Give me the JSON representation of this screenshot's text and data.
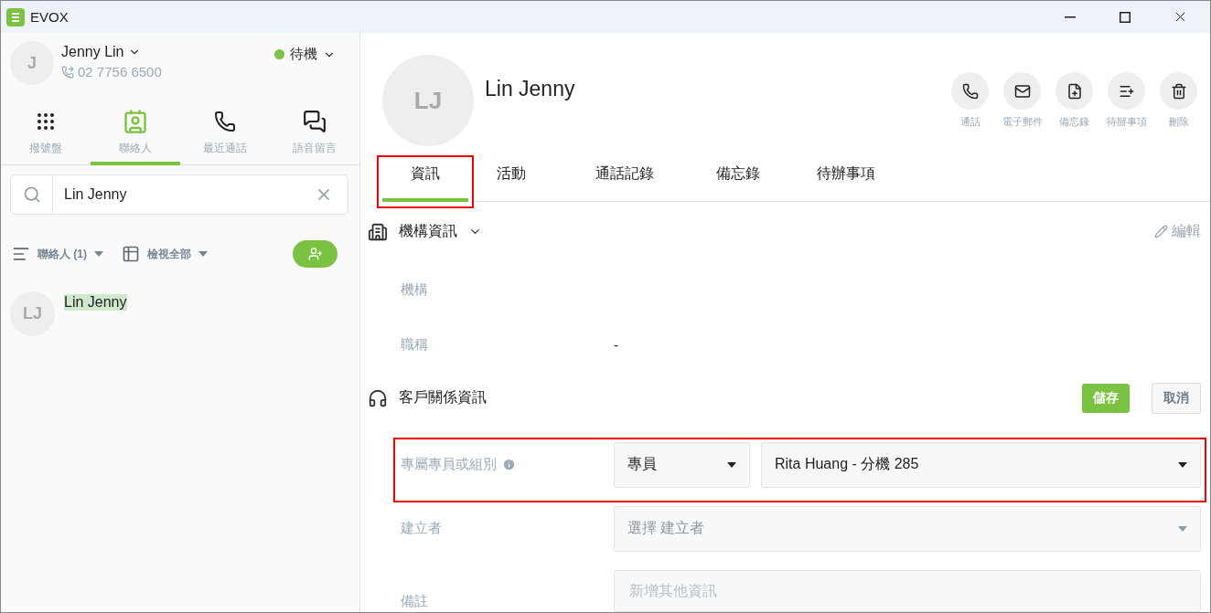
{
  "window": {
    "title": "EVOX"
  },
  "user": {
    "initial": "J",
    "name": "Jenny Lin",
    "phone": "02 7756 6500",
    "status": "待機"
  },
  "nav": [
    {
      "label": "撥號盤",
      "selected": false
    },
    {
      "label": "聯絡人",
      "selected": true
    },
    {
      "label": "最近通話",
      "selected": false
    },
    {
      "label": "語音留言",
      "selected": false
    }
  ],
  "search": {
    "value": "Lin Jenny"
  },
  "filters": [
    {
      "label": "聯絡人 (1)"
    },
    {
      "label": "檢視全部"
    }
  ],
  "contacts": [
    {
      "initials": "LJ",
      "name": "Lin Jenny",
      "selected": true
    }
  ],
  "contact": {
    "initials": "LJ",
    "name": "Lin Jenny"
  },
  "actions": [
    {
      "label": "通話"
    },
    {
      "label": "電子郵件"
    },
    {
      "label": "備忘錄"
    },
    {
      "label": "待辦事項"
    },
    {
      "label": "刪除"
    }
  ],
  "tabs": [
    {
      "label": "資訊",
      "selected": true,
      "highlighted": true
    },
    {
      "label": "活動",
      "selected": false,
      "highlighted": false
    },
    {
      "label": "通話記錄",
      "selected": false,
      "highlighted": false
    },
    {
      "label": "備忘錄",
      "selected": false,
      "highlighted": false
    },
    {
      "label": "待辦事項",
      "selected": false,
      "highlighted": false
    }
  ],
  "org_section": {
    "title": "機構資訊",
    "edit": "編輯",
    "fields": [
      {
        "label": "機構"
      },
      {
        "label": "職稱",
        "value": "-"
      }
    ]
  },
  "crm_section": {
    "title": "客戶關係資訊",
    "save": "儲存",
    "cancel": "取消",
    "fields": [
      {
        "kind": "assign",
        "label": "專屬專員或組別",
        "type": "專員",
        "value": "Rita Huang - 分機 285",
        "highlighted": true
      },
      {
        "kind": "select",
        "label": "建立者",
        "placeholder": "選擇 建立者"
      },
      {
        "kind": "text",
        "label": "備註",
        "placeholder": "新增其他資訊"
      }
    ]
  }
}
